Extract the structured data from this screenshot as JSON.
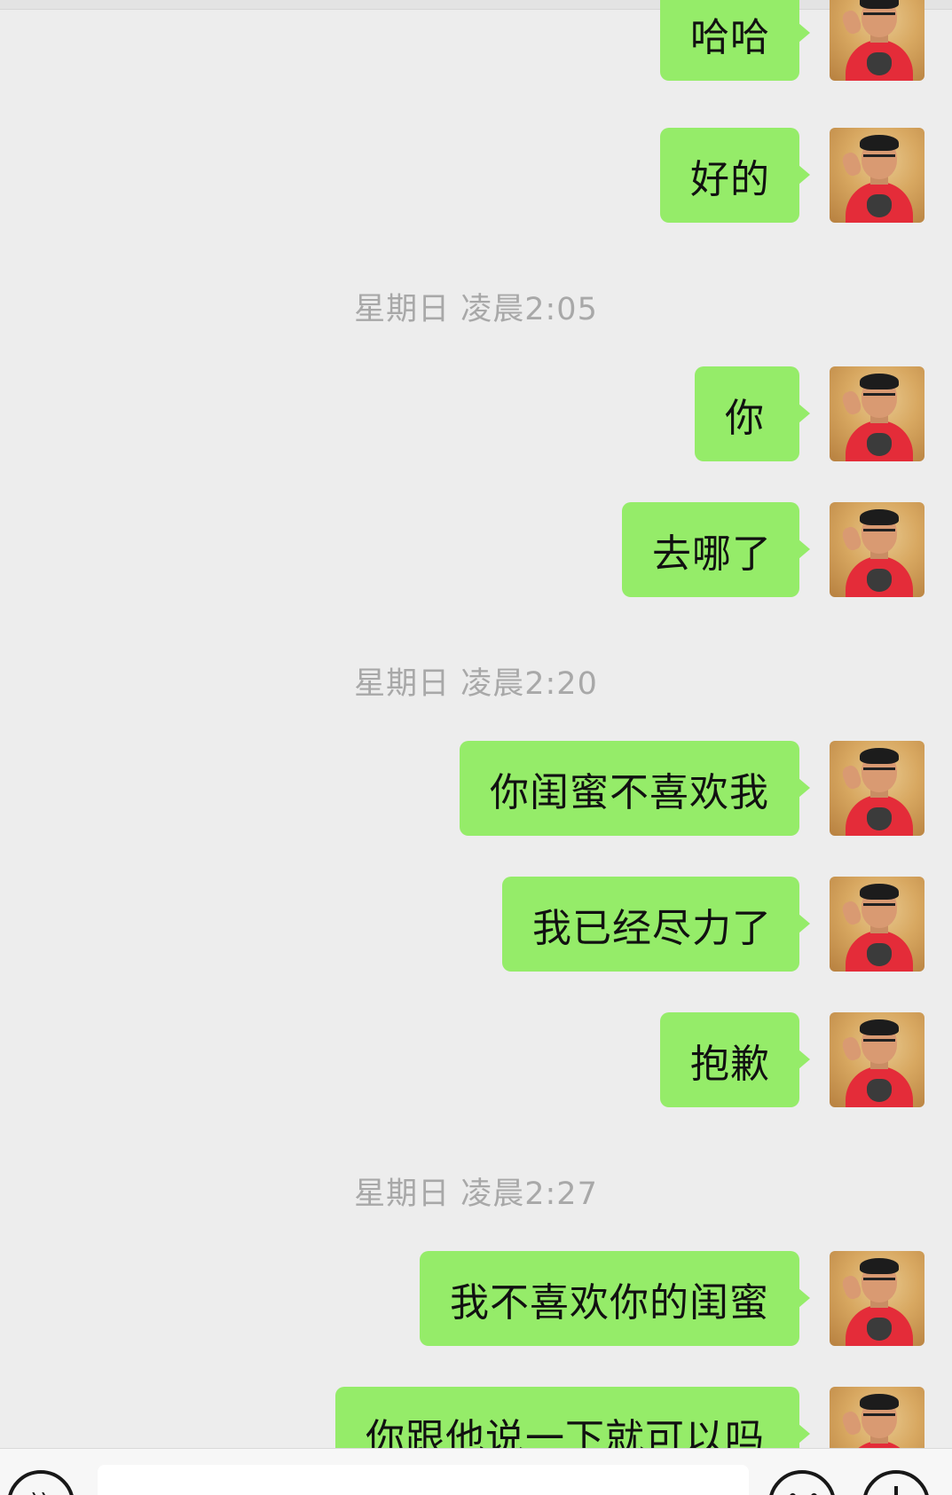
{
  "timestamps": [
    "星期日 凌晨2:05",
    "星期日 凌晨2:20",
    "星期日 凌晨2:27"
  ],
  "messages": [
    {
      "text": "哈哈"
    },
    {
      "text": "好的"
    },
    {
      "text": "你"
    },
    {
      "text": "去哪了"
    },
    {
      "text": "你闺蜜不喜欢我"
    },
    {
      "text": "我已经尽力了"
    },
    {
      "text": "抱歉"
    },
    {
      "text": "我不喜欢你的闺蜜"
    },
    {
      "text": "你跟他说一下就可以吗"
    }
  ],
  "input_bar": {
    "text_value": "",
    "voice_icon": "voice-icon",
    "emoji_icon": "emoji-icon",
    "plus_icon": "plus-icon"
  },
  "colors": {
    "background": "#ededed",
    "bubble_sent": "#95ec69",
    "timestamp_text": "#a8a8a8"
  }
}
